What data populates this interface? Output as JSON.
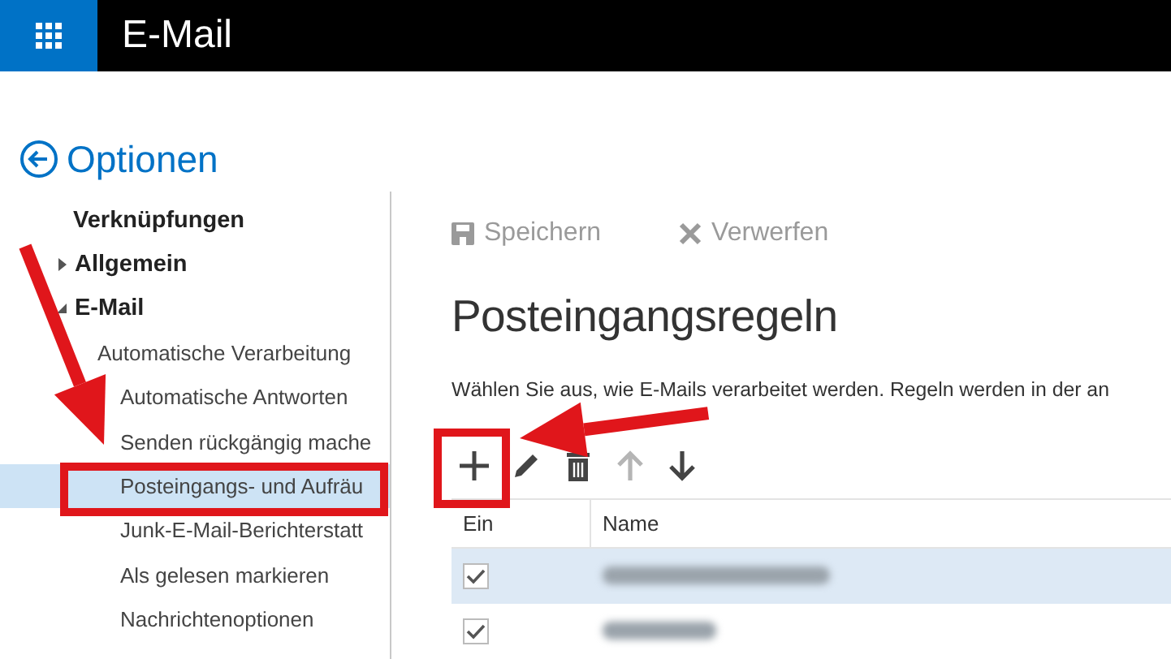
{
  "app": {
    "title": "E-Mail"
  },
  "page": {
    "back_title": "Optionen"
  },
  "sidebar": {
    "items": [
      {
        "label": "Verknüpfungen",
        "kind": "heading"
      },
      {
        "label": "Allgemein",
        "kind": "group",
        "expanded": false
      },
      {
        "label": "E-Mail",
        "kind": "group",
        "expanded": true,
        "children": [
          {
            "label": "Automatische Verarbeitung",
            "kind": "subgroup",
            "children": [
              {
                "label": "Automatische Antworten",
                "kind": "link",
                "selected": false
              },
              {
                "label": "Senden rückgängig mache",
                "kind": "link",
                "selected": false
              },
              {
                "label": "Posteingangs- und Aufräu",
                "kind": "link",
                "selected": true
              },
              {
                "label": "Junk-E-Mail-Berichterstatt",
                "kind": "link",
                "selected": false
              },
              {
                "label": "Als gelesen markieren",
                "kind": "link",
                "selected": false
              },
              {
                "label": "Nachrichtenoptionen",
                "kind": "link",
                "selected": false
              }
            ]
          }
        ]
      }
    ]
  },
  "toolbar": [
    {
      "label": "Speichern",
      "kind": "save",
      "disabled": true
    },
    {
      "label": "Verwerfen",
      "kind": "discard",
      "disabled": true
    }
  ],
  "title": "Posteingangsregeln",
  "description": "Wählen Sie aus, wie E-Mails verarbeitet werden. Regeln werden in der an",
  "rule_tools": [
    {
      "kind": "add",
      "disabled": false
    },
    {
      "kind": "edit",
      "disabled": false
    },
    {
      "kind": "delete",
      "disabled": false
    },
    {
      "kind": "up",
      "disabled": true
    },
    {
      "kind": "down",
      "disabled": false
    }
  ],
  "table": {
    "columns": [
      "Ein",
      "Name"
    ],
    "rows": [
      {
        "on": true,
        "selected": true
      },
      {
        "on": true,
        "selected": false
      }
    ]
  },
  "annotations": [
    {
      "kind": "box"
    },
    {
      "kind": "box"
    },
    {
      "kind": "arrow"
    },
    {
      "kind": "arrow"
    }
  ]
}
